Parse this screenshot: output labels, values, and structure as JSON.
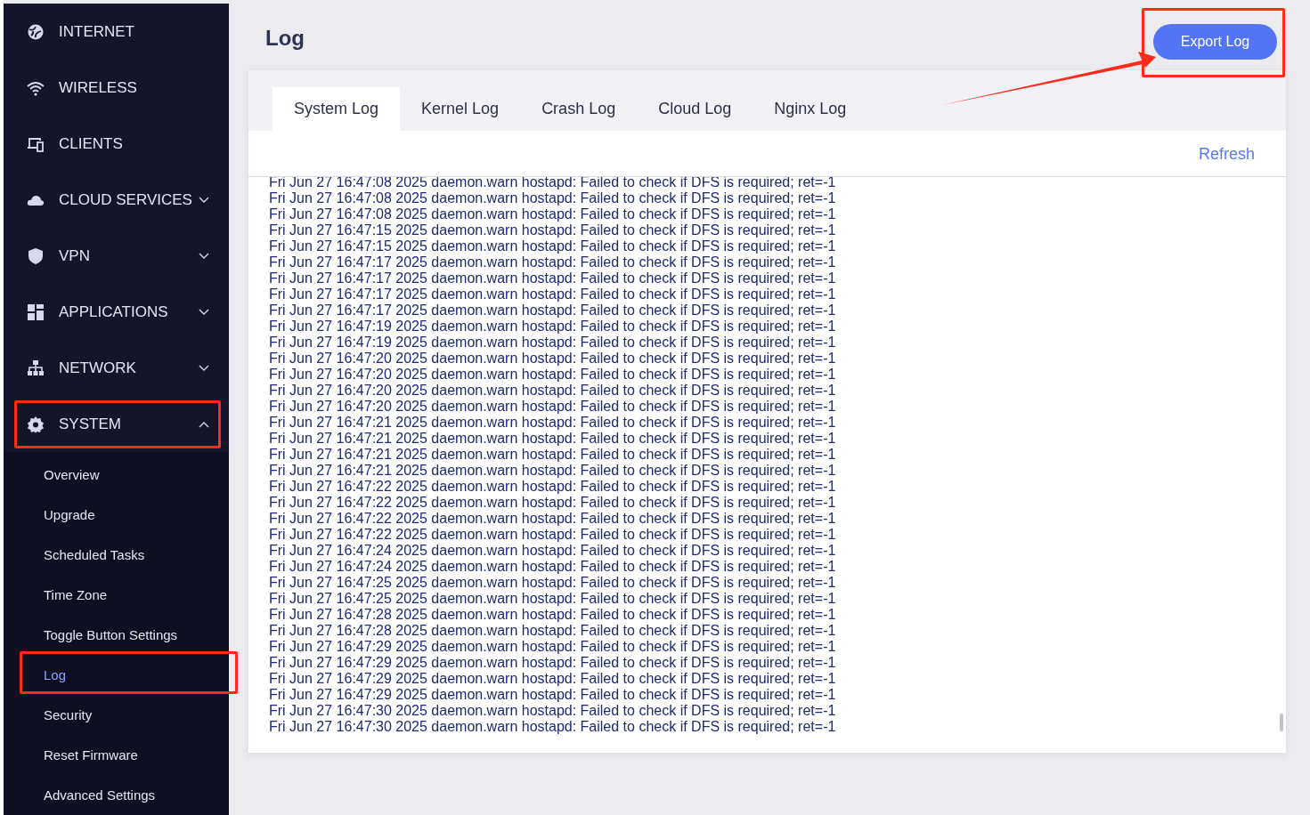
{
  "sidebar": {
    "items": [
      {
        "label": "INTERNET",
        "kind": "link"
      },
      {
        "label": "WIRELESS",
        "kind": "link"
      },
      {
        "label": "CLIENTS",
        "kind": "link"
      },
      {
        "label": "CLOUD SERVICES",
        "kind": "group",
        "expanded": false
      },
      {
        "label": "VPN",
        "kind": "group",
        "expanded": false
      },
      {
        "label": "APPLICATIONS",
        "kind": "group",
        "expanded": false
      },
      {
        "label": "NETWORK",
        "kind": "group",
        "expanded": false
      },
      {
        "label": "SYSTEM",
        "kind": "group",
        "expanded": true,
        "children": [
          {
            "label": "Overview",
            "selected": false
          },
          {
            "label": "Upgrade",
            "selected": false
          },
          {
            "label": "Scheduled Tasks",
            "selected": false
          },
          {
            "label": "Time Zone",
            "selected": false
          },
          {
            "label": "Toggle Button Settings",
            "selected": false
          },
          {
            "label": "Log",
            "selected": true
          },
          {
            "label": "Security",
            "selected": false
          },
          {
            "label": "Reset Firmware",
            "selected": false
          },
          {
            "label": "Advanced Settings",
            "selected": false
          }
        ]
      }
    ]
  },
  "page": {
    "title": "Log",
    "export_button": "Export Log"
  },
  "tabs": [
    {
      "label": "System Log",
      "selected": true
    },
    {
      "label": "Kernel Log",
      "selected": false
    },
    {
      "label": "Crash Log",
      "selected": false
    },
    {
      "label": "Cloud Log",
      "selected": false
    },
    {
      "label": "Nginx Log",
      "selected": false
    }
  ],
  "refresh": "Refresh",
  "log_lines": [
    "Fri Jun 27 16:47:08 2025 daemon.warn hostapd: Failed to check if DFS is required; ret=-1",
    "Fri Jun 27 16:47:08 2025 daemon.warn hostapd: Failed to check if DFS is required; ret=-1",
    "Fri Jun 27 16:47:08 2025 daemon.warn hostapd: Failed to check if DFS is required; ret=-1",
    "Fri Jun 27 16:47:15 2025 daemon.warn hostapd: Failed to check if DFS is required; ret=-1",
    "Fri Jun 27 16:47:15 2025 daemon.warn hostapd: Failed to check if DFS is required; ret=-1",
    "Fri Jun 27 16:47:17 2025 daemon.warn hostapd: Failed to check if DFS is required; ret=-1",
    "Fri Jun 27 16:47:17 2025 daemon.warn hostapd: Failed to check if DFS is required; ret=-1",
    "Fri Jun 27 16:47:17 2025 daemon.warn hostapd: Failed to check if DFS is required; ret=-1",
    "Fri Jun 27 16:47:17 2025 daemon.warn hostapd: Failed to check if DFS is required; ret=-1",
    "Fri Jun 27 16:47:19 2025 daemon.warn hostapd: Failed to check if DFS is required; ret=-1",
    "Fri Jun 27 16:47:19 2025 daemon.warn hostapd: Failed to check if DFS is required; ret=-1",
    "Fri Jun 27 16:47:20 2025 daemon.warn hostapd: Failed to check if DFS is required; ret=-1",
    "Fri Jun 27 16:47:20 2025 daemon.warn hostapd: Failed to check if DFS is required; ret=-1",
    "Fri Jun 27 16:47:20 2025 daemon.warn hostapd: Failed to check if DFS is required; ret=-1",
    "Fri Jun 27 16:47:20 2025 daemon.warn hostapd: Failed to check if DFS is required; ret=-1",
    "Fri Jun 27 16:47:21 2025 daemon.warn hostapd: Failed to check if DFS is required; ret=-1",
    "Fri Jun 27 16:47:21 2025 daemon.warn hostapd: Failed to check if DFS is required; ret=-1",
    "Fri Jun 27 16:47:21 2025 daemon.warn hostapd: Failed to check if DFS is required; ret=-1",
    "Fri Jun 27 16:47:21 2025 daemon.warn hostapd: Failed to check if DFS is required; ret=-1",
    "Fri Jun 27 16:47:22 2025 daemon.warn hostapd: Failed to check if DFS is required; ret=-1",
    "Fri Jun 27 16:47:22 2025 daemon.warn hostapd: Failed to check if DFS is required; ret=-1",
    "Fri Jun 27 16:47:22 2025 daemon.warn hostapd: Failed to check if DFS is required; ret=-1",
    "Fri Jun 27 16:47:22 2025 daemon.warn hostapd: Failed to check if DFS is required; ret=-1",
    "Fri Jun 27 16:47:24 2025 daemon.warn hostapd: Failed to check if DFS is required; ret=-1",
    "Fri Jun 27 16:47:24 2025 daemon.warn hostapd: Failed to check if DFS is required; ret=-1",
    "Fri Jun 27 16:47:25 2025 daemon.warn hostapd: Failed to check if DFS is required; ret=-1",
    "Fri Jun 27 16:47:25 2025 daemon.warn hostapd: Failed to check if DFS is required; ret=-1",
    "Fri Jun 27 16:47:28 2025 daemon.warn hostapd: Failed to check if DFS is required; ret=-1",
    "Fri Jun 27 16:47:28 2025 daemon.warn hostapd: Failed to check if DFS is required; ret=-1",
    "Fri Jun 27 16:47:29 2025 daemon.warn hostapd: Failed to check if DFS is required; ret=-1",
    "Fri Jun 27 16:47:29 2025 daemon.warn hostapd: Failed to check if DFS is required; ret=-1",
    "Fri Jun 27 16:47:29 2025 daemon.warn hostapd: Failed to check if DFS is required; ret=-1",
    "Fri Jun 27 16:47:29 2025 daemon.warn hostapd: Failed to check if DFS is required; ret=-1",
    "Fri Jun 27 16:47:30 2025 daemon.warn hostapd: Failed to check if DFS is required; ret=-1",
    "Fri Jun 27 16:47:30 2025 daemon.warn hostapd: Failed to check if DFS is required; ret=-1"
  ]
}
